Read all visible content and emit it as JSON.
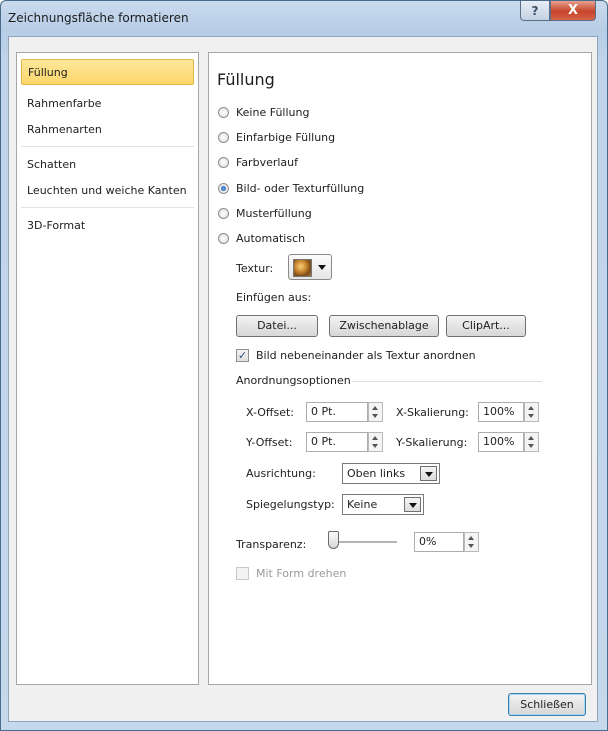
{
  "window": {
    "title": "Zeichnungsfläche formatieren",
    "help_glyph": "?",
    "close_glyph": "X"
  },
  "nav": {
    "items": [
      "Füllung",
      "Rahmenfarbe",
      "Rahmenarten",
      "Schatten",
      "Leuchten und weiche Kanten",
      "3D-Format"
    ],
    "selected": "Füllung"
  },
  "panel": {
    "heading": "Füllung",
    "fill_options": [
      {
        "label": "Keine Füllung",
        "selected": false
      },
      {
        "label": "Einfarbige Füllung",
        "selected": false
      },
      {
        "label": "Farbverlauf",
        "selected": false
      },
      {
        "label": "Bild- oder Texturfüllung",
        "selected": true
      },
      {
        "label": "Musterfüllung",
        "selected": false
      },
      {
        "label": "Automatisch",
        "selected": false
      }
    ],
    "texture_label": "Textur:",
    "insert_from_label": "Einfügen aus:",
    "buttons": {
      "file": "Datei...",
      "clipboard": "Zwischenablage",
      "clipart": "ClipArt..."
    },
    "tile_checkbox": {
      "label": "Bild nebeneinander als Textur anordnen",
      "checked": true
    },
    "tiling_options_label": "Anordnungsoptionen",
    "x_offset": {
      "label": "X-Offset:",
      "value": "0 Pt."
    },
    "y_offset": {
      "label": "Y-Offset:",
      "value": "0 Pt."
    },
    "x_scale": {
      "label": "X-Skalierung:",
      "value": "100%"
    },
    "y_scale": {
      "label": "Y-Skalierung:",
      "value": "100%"
    },
    "alignment": {
      "label": "Ausrichtung:",
      "value": "Oben links"
    },
    "mirror": {
      "label": "Spiegelungstyp:",
      "value": "Keine"
    },
    "transparency": {
      "label": "Transparenz:",
      "value": "0%",
      "level": 0
    },
    "rotate_with_shape": {
      "label": "Mit Form drehen",
      "checked": false,
      "enabled": false
    }
  },
  "footer": {
    "close_label": "Schließen"
  },
  "colors": {
    "accent_selection": "#fcd66a",
    "frame": "#bfd3ea"
  }
}
